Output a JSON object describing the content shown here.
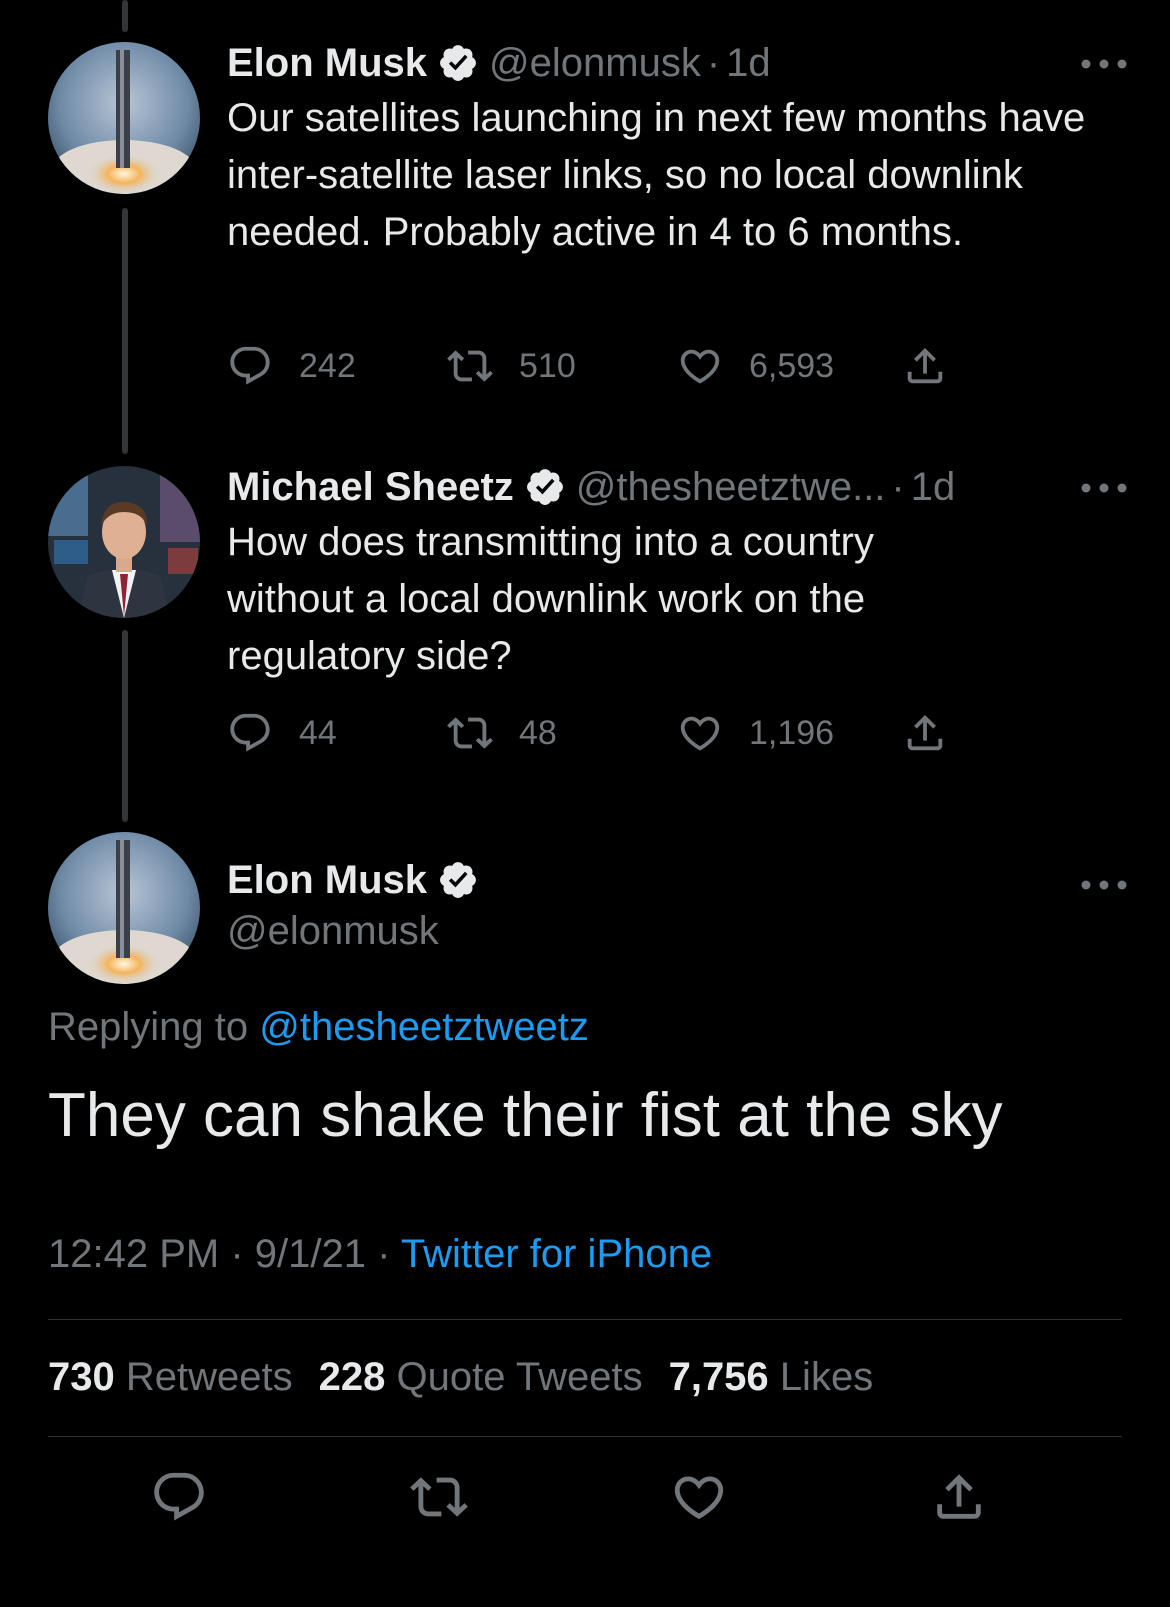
{
  "tweet1": {
    "name": "Elon Musk",
    "handle": "@elonmusk",
    "time": "1d",
    "text": "Our satellites launching in next few months have inter-satellite laser links, so no local downlink needed. Probably active in 4 to 6 months.",
    "replies": "242",
    "retweets": "510",
    "likes": "6,593"
  },
  "tweet2": {
    "name": "Michael Sheetz",
    "handle": "@thesheetztwe...",
    "time": "1d",
    "text": "How does transmitting into a country without a local downlink work on the regulatory side?",
    "replies": "44",
    "retweets": "48",
    "likes": "1,196"
  },
  "main": {
    "name": "Elon Musk",
    "handle": "@elonmusk",
    "replying_prefix": "Replying to",
    "replying_handle": "@thesheetztweetz",
    "text": "They can shake their fist at the sky",
    "time": "12:42 PM",
    "date": "9/1/21",
    "source": "Twitter for iPhone",
    "retweets_count": "730",
    "retweets_label": "Retweets",
    "quotes_count": "228",
    "quotes_label": "Quote Tweets",
    "likes_count": "7,756",
    "likes_label": "Likes"
  },
  "separator": "·",
  "colors": {
    "background": "#000000",
    "text": "#e7e9ea",
    "muted": "#71767b",
    "link": "#1d9bf0",
    "divider": "#2f3336"
  },
  "icons": [
    "reply-icon",
    "retweet-icon",
    "like-icon",
    "share-icon",
    "verified-badge-icon",
    "more-icon"
  ]
}
